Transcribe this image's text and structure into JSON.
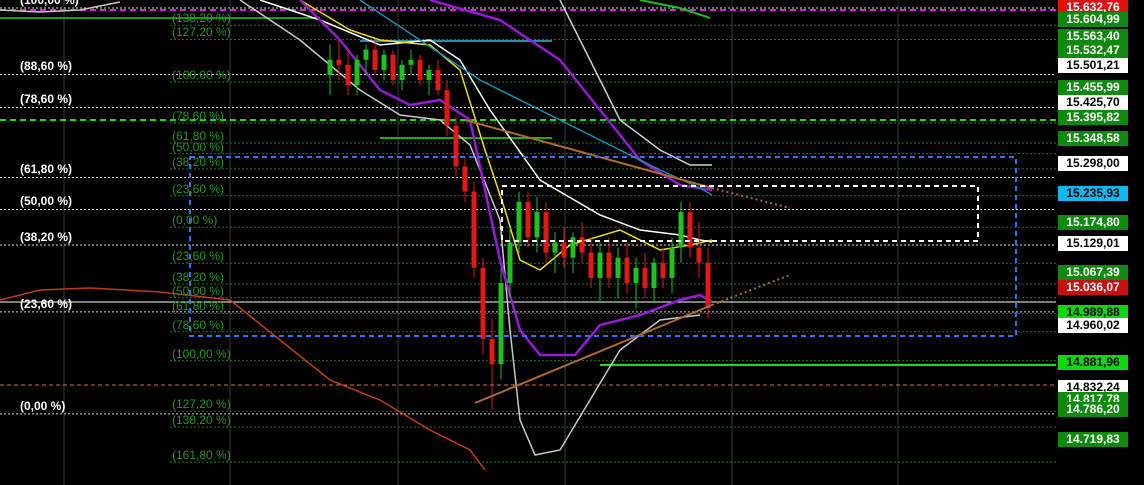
{
  "colors": {
    "background": "#000000",
    "grid": "#3a3a3a",
    "candle_up": "#20c020",
    "candle_down": "#e01818",
    "ema_white": "#ffffff",
    "ema_yellow": "#f0e000",
    "band_purple": "#9a18d8",
    "ma_teal": "#1a90b0",
    "bollinger_gray": "#c8c8c8",
    "trend_brown": "#b06a2a",
    "osc_red": "#c83a10",
    "magenta": "#e020e0",
    "accent_green": "#18e018",
    "box_blue": "#3070ff"
  },
  "chart_data": {
    "type": "candlestick",
    "title": "",
    "y_axis": {
      "side": "right",
      "min": 14.7,
      "max": 15.64
    },
    "price_labels": [
      {
        "value": "15.632,76",
        "style": "red"
      },
      {
        "value": "15.604,99",
        "style": "green"
      },
      {
        "value": "15.563,40",
        "style": "green"
      },
      {
        "value": "15.532,47",
        "style": "green"
      },
      {
        "value": "15.501,21",
        "style": "white"
      },
      {
        "value": "15.455,99",
        "style": "green"
      },
      {
        "value": "15.425,70",
        "style": "white"
      },
      {
        "value": "15.395,82",
        "style": "green"
      },
      {
        "value": "15.348,58",
        "style": "green"
      },
      {
        "value": "15.298,00",
        "style": "white"
      },
      {
        "value": "15.235,93",
        "style": "cyan"
      },
      {
        "value": "15.174,80",
        "style": "green"
      },
      {
        "value": "15.129,01",
        "style": "white"
      },
      {
        "value": "15.067,39",
        "style": "green"
      },
      {
        "value": "15.036,07",
        "style": "darkred"
      },
      {
        "value": "14.989,88",
        "style": "brightgreen"
      },
      {
        "value": "14.960,02",
        "style": "white"
      },
      {
        "value": "14.881,96",
        "style": "brightgreen"
      },
      {
        "value": "14.832,24",
        "style": "white"
      },
      {
        "value": "14.817,78",
        "style": "green"
      },
      {
        "value": "14.786,20",
        "style": "green"
      },
      {
        "value": "14.719,83",
        "style": "green"
      }
    ],
    "fib_main": [
      {
        "label": "(100,00 %)",
        "value": 15.632
      },
      {
        "label": "(88,60 %)",
        "value": 15.501
      },
      {
        "label": "(78,60 %)",
        "value": 15.436
      },
      {
        "label": "(61,80 %)",
        "value": 15.298
      },
      {
        "label": "(50,00 %)",
        "value": 15.235
      },
      {
        "label": "(38,20 %)",
        "value": 15.165
      },
      {
        "label": "(23,60 %)",
        "value": 15.033
      },
      {
        "label": "(0,00 %)",
        "value": 14.832
      }
    ],
    "fib_secondary": [
      {
        "label": "(138,20 %)",
        "value": 15.598
      },
      {
        "label": "(127,20 %)",
        "value": 15.57
      },
      {
        "label": "(100,00 %)",
        "value": 15.486
      },
      {
        "label": "(78,60 %)",
        "value": 15.405
      },
      {
        "label": "(61,80 %)",
        "value": 15.366
      },
      {
        "label": "(50,00 %)",
        "value": 15.345
      },
      {
        "label": "(38,20 %)",
        "value": 15.315
      },
      {
        "label": "(23,60 %)",
        "value": 15.262
      },
      {
        "label": "(0,00 %)",
        "value": 15.2
      },
      {
        "label": "(23,60 %)",
        "value": 15.129
      },
      {
        "label": "(38,20 %)",
        "value": 15.088
      },
      {
        "label": "(50,00 %)",
        "value": 15.061
      },
      {
        "label": "(61,80 %)",
        "value": 15.03
      },
      {
        "label": "(78,60 %)",
        "value": 14.994
      },
      {
        "label": "(100,00 %)",
        "value": 14.937
      },
      {
        "label": "(127,20 %)",
        "value": 14.837
      },
      {
        "label": "(138,20 %)",
        "value": 14.806
      },
      {
        "label": "(161,80 %)",
        "value": 14.737
      }
    ],
    "candles": [
      {
        "o": 15.5,
        "h": 15.56,
        "l": 15.46,
        "c": 15.53
      },
      {
        "o": 15.53,
        "h": 15.57,
        "l": 15.49,
        "c": 15.52
      },
      {
        "o": 15.52,
        "h": 15.55,
        "l": 15.46,
        "c": 15.48
      },
      {
        "o": 15.48,
        "h": 15.54,
        "l": 15.46,
        "c": 15.53
      },
      {
        "o": 15.53,
        "h": 15.56,
        "l": 15.5,
        "c": 15.55
      },
      {
        "o": 15.55,
        "h": 15.57,
        "l": 15.5,
        "c": 15.51
      },
      {
        "o": 15.51,
        "h": 15.55,
        "l": 15.49,
        "c": 15.54
      },
      {
        "o": 15.54,
        "h": 15.55,
        "l": 15.48,
        "c": 15.49
      },
      {
        "o": 15.49,
        "h": 15.53,
        "l": 15.47,
        "c": 15.52
      },
      {
        "o": 15.52,
        "h": 15.55,
        "l": 15.5,
        "c": 15.53
      },
      {
        "o": 15.53,
        "h": 15.54,
        "l": 15.48,
        "c": 15.49
      },
      {
        "o": 15.49,
        "h": 15.52,
        "l": 15.46,
        "c": 15.51
      },
      {
        "o": 15.51,
        "h": 15.53,
        "l": 15.46,
        "c": 15.47
      },
      {
        "o": 15.47,
        "h": 15.49,
        "l": 15.38,
        "c": 15.4
      },
      {
        "o": 15.4,
        "h": 15.42,
        "l": 15.3,
        "c": 15.32
      },
      {
        "o": 15.32,
        "h": 15.34,
        "l": 15.25,
        "c": 15.27
      },
      {
        "o": 15.27,
        "h": 15.29,
        "l": 15.1,
        "c": 15.12
      },
      {
        "o": 15.12,
        "h": 15.14,
        "l": 14.95,
        "c": 14.98
      },
      {
        "o": 14.98,
        "h": 15.02,
        "l": 14.84,
        "c": 14.93
      },
      {
        "o": 14.93,
        "h": 15.12,
        "l": 14.9,
        "c": 15.09
      },
      {
        "o": 15.09,
        "h": 15.2,
        "l": 15.06,
        "c": 15.17
      },
      {
        "o": 15.17,
        "h": 15.27,
        "l": 15.15,
        "c": 15.25
      },
      {
        "o": 15.25,
        "h": 15.27,
        "l": 15.16,
        "c": 15.18
      },
      {
        "o": 15.18,
        "h": 15.26,
        "l": 15.15,
        "c": 15.23
      },
      {
        "o": 15.23,
        "h": 15.25,
        "l": 15.13,
        "c": 15.15
      },
      {
        "o": 15.15,
        "h": 15.19,
        "l": 15.11,
        "c": 15.17
      },
      {
        "o": 15.17,
        "h": 15.2,
        "l": 15.12,
        "c": 15.14
      },
      {
        "o": 15.14,
        "h": 15.19,
        "l": 15.11,
        "c": 15.18
      },
      {
        "o": 15.18,
        "h": 15.21,
        "l": 15.13,
        "c": 15.15
      },
      {
        "o": 15.15,
        "h": 15.18,
        "l": 15.08,
        "c": 15.1
      },
      {
        "o": 15.1,
        "h": 15.17,
        "l": 15.05,
        "c": 15.15
      },
      {
        "o": 15.15,
        "h": 15.18,
        "l": 15.08,
        "c": 15.1
      },
      {
        "o": 15.1,
        "h": 15.16,
        "l": 15.06,
        "c": 15.14
      },
      {
        "o": 15.14,
        "h": 15.17,
        "l": 15.07,
        "c": 15.09
      },
      {
        "o": 15.09,
        "h": 15.14,
        "l": 15.04,
        "c": 15.12
      },
      {
        "o": 15.12,
        "h": 15.15,
        "l": 15.06,
        "c": 15.08
      },
      {
        "o": 15.08,
        "h": 15.14,
        "l": 15.05,
        "c": 15.13
      },
      {
        "o": 15.13,
        "h": 15.16,
        "l": 15.08,
        "c": 15.1
      },
      {
        "o": 15.1,
        "h": 15.18,
        "l": 15.07,
        "c": 15.16
      },
      {
        "o": 15.16,
        "h": 15.25,
        "l": 15.13,
        "c": 15.23
      },
      {
        "o": 15.23,
        "h": 15.25,
        "l": 15.14,
        "c": 15.16
      },
      {
        "o": 15.16,
        "h": 15.21,
        "l": 15.1,
        "c": 15.13
      },
      {
        "o": 15.13,
        "h": 15.16,
        "l": 15.02,
        "c": 15.04
      }
    ]
  }
}
